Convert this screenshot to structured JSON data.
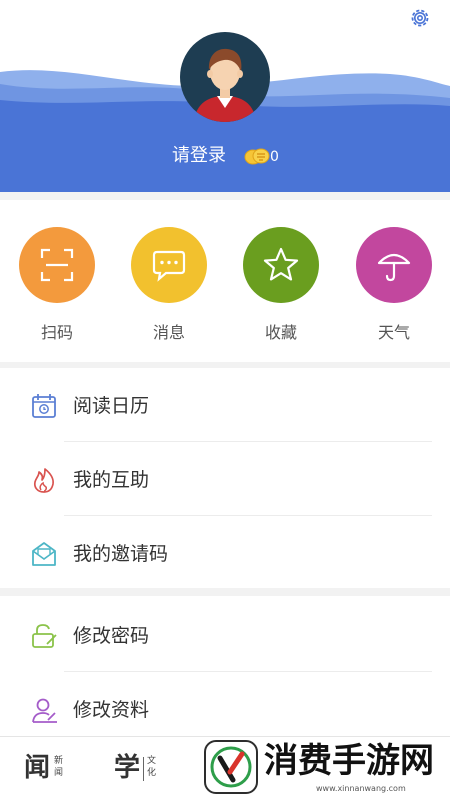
{
  "header": {
    "login_text": "请登录",
    "coin_count": "0"
  },
  "actions": [
    {
      "label": "扫码",
      "icon": "scan-icon",
      "color": "#F39A3D"
    },
    {
      "label": "消息",
      "icon": "message-icon",
      "color": "#F2C12E"
    },
    {
      "label": "收藏",
      "icon": "star-icon",
      "color": "#6A9E1F"
    },
    {
      "label": "天气",
      "icon": "umbrella-icon",
      "color": "#C2479E"
    }
  ],
  "menu_group_1": [
    {
      "label": "阅读日历",
      "icon": "calendar-icon"
    },
    {
      "label": "我的互助",
      "icon": "flame-icon"
    },
    {
      "label": "我的邀请码",
      "icon": "envelope-icon"
    }
  ],
  "menu_group_2": [
    {
      "label": "修改密码",
      "icon": "lock-icon"
    },
    {
      "label": "修改资料",
      "icon": "user-edit-icon"
    }
  ],
  "bottom_tabs": [
    {
      "big": "闻",
      "small": "新闻"
    },
    {
      "big": "学",
      "small": "文化"
    }
  ],
  "watermark": {
    "title": "消费手游网",
    "url": "www.xinnanwang.com"
  },
  "colors": {
    "header_blue": "#4A74D6",
    "wave_light": "#7DA0E6"
  }
}
